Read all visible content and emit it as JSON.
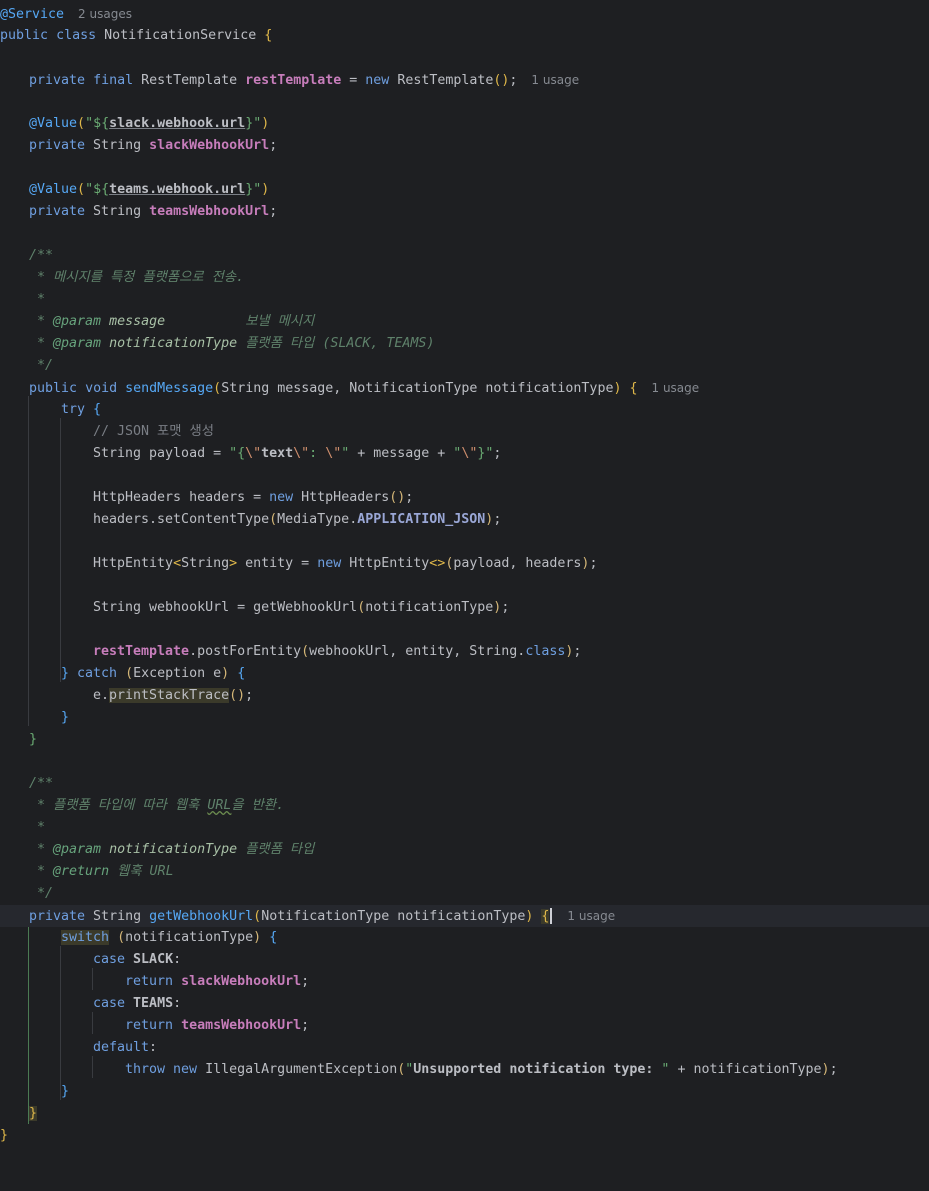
{
  "editor": {
    "language": "Java",
    "usage_hints": {
      "service": "2 usages",
      "rest_template": "1 usage",
      "send_message": "1 usage",
      "get_webhook_url": "1 usage"
    },
    "lines": [
      "@Service",
      "public class NotificationService {",
      "",
      "private final RestTemplate restTemplate = new RestTemplate();",
      "",
      "@Value(\"${slack.webhook.url}\")",
      "private String slackWebhookUrl;",
      "",
      "@Value(\"${teams.webhook.url}\")",
      "private String teamsWebhookUrl;",
      "",
      "/**",
      "* 메시지를 특정 플랫폼으로 전송.",
      "*",
      "* @param message          보낼 메시지",
      "* @param notificationType 플랫폼 타입 (SLACK, TEAMS)",
      "*/",
      "public void sendMessage(String message, NotificationType notificationType) {",
      "try {",
      "// JSON 포맷 생성",
      "String payload = \"{\\\"text\\\": \\\"\" + message + \"\\\"}\";",
      "",
      "HttpHeaders headers = new HttpHeaders();",
      "headers.setContentType(MediaType.APPLICATION_JSON);",
      "",
      "HttpEntity<String> entity = new HttpEntity<>(payload, headers);",
      "",
      "String webhookUrl = getWebhookUrl(notificationType);",
      "",
      "restTemplate.postForEntity(webhookUrl, entity, String.class);",
      "} catch (Exception e) {",
      "e.printStackTrace();",
      "}",
      "}",
      "",
      "/**",
      "* 플랫폼 타입에 따라 웹훅 URL을 반환.",
      "*",
      "* @param notificationType 플랫폼 타입",
      "* @return 웹훅 URL",
      "*/",
      "private String getWebhookUrl(NotificationType notificationType) {",
      "switch (notificationType) {",
      "case SLACK:",
      "return slackWebhookUrl;",
      "case TEAMS:",
      "return teamsWebhookUrl;",
      "default:",
      "throw new IllegalArgumentException(\"Unsupported notification type: \" + notificationType);",
      "}",
      "}",
      "}"
    ]
  },
  "colors": {
    "background": "#1e1f22",
    "text": "#bcbec4",
    "keyword": "#cf8e6d",
    "annotation": "#b3ae60",
    "string": "#6aab73",
    "field": "#c77dbb",
    "method": "#56a8f5",
    "doc_comment": "#5f826b",
    "line_comment": "#7a7e85",
    "usage_hint": "#868a91"
  }
}
